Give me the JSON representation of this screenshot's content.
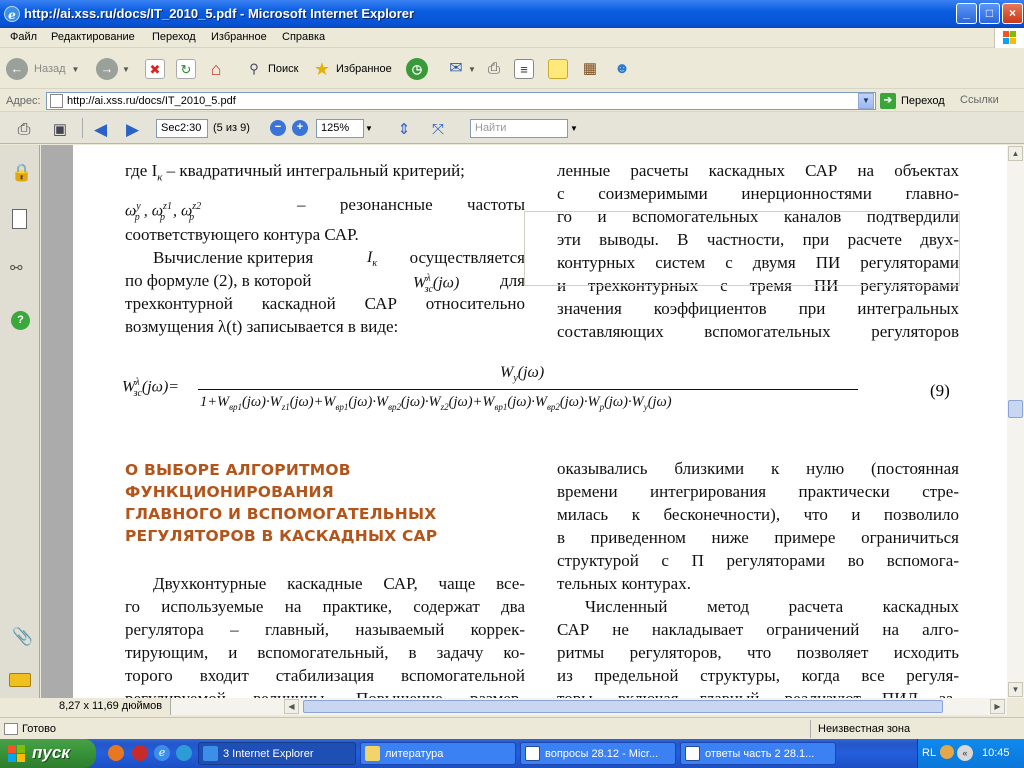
{
  "window": {
    "title": "http://ai.xss.ru/docs/IT_2010_5.pdf - Microsoft Internet Explorer",
    "controls": {
      "minimize": "_",
      "maximize": "□",
      "close": "×"
    }
  },
  "menu": [
    "Файл",
    "Редактирование",
    "Переход",
    "Избранное",
    "Справка"
  ],
  "toolbar": {
    "back": "Назад",
    "search": "Поиск",
    "favorites": "Избранное"
  },
  "address": {
    "label": "Адрес:",
    "url": "http://ai.xss.ru/docs/IT_2010_5.pdf",
    "go": "Переход",
    "links": "Ссылки"
  },
  "pdf": {
    "page_label": "Sec2:30",
    "page_count": "(5 из 9)",
    "zoom": "125%",
    "find_placeholder": "Найти"
  },
  "document": {
    "left_column_top": [
      "где I",
      "к",
      " – квадратичный интегральный критерий;"
    ],
    "resonance_text": "– резонансные частоты",
    "resonance_text2": "соответствующего контура САР.",
    "calc_para": "Вычисление критерия",
    "calc_para2": "осуществляется",
    "calc_para3": "по формуле (2), в которой",
    "calc_para4": "для",
    "calc_para5": "трехконтурной каскадной САР относительно",
    "calc_para6": "возмущения λ(t) записывается в виде:",
    "right_top": [
      "ленные расчеты каскадных САР на объектах",
      "с соизмеримыми инерционностями главно-",
      "го и вспомогательных каналов подтвердили",
      "эти выводы. В частности, при расчете двух-",
      "контурных систем с двумя ПИ регуляторами",
      "и трехконтурных с тремя ПИ регуляторами",
      "значения коэффициентов при интегральных",
      "составляющих вспомогательных регуляторов"
    ],
    "formula_number": "(9)",
    "heading": [
      "О ВЫБОРЕ АЛГОРИТМОВ",
      "ФУНКЦИОНИРОВАНИЯ",
      "ГЛАВНОГО И ВСПОМОГАТЕЛЬНЫХ",
      "РЕГУЛЯТОРОВ В КАСКАДНЫХ САР"
    ],
    "left_bottom": [
      "Двухконтурные каскадные САР, чаще все-",
      "го используемые на практике, содержат два",
      "регулятора – главный, называемый коррек-",
      "тирующим, и вспомогательный, в задачу ко-",
      "торого входит стабилизация вспомогательной",
      "регулируемой величины. Повышение размер-"
    ],
    "right_bottom": [
      "оказывались близкими к нулю (постоянная",
      "времени интегрирования практически стре-",
      "милась к бесконечности), что и позволило",
      "в приведенном ниже примере ограничиться",
      "структурой с П регуляторами во вспомога-",
      "тельных контурах."
    ],
    "right_bottom2": [
      "Численный метод расчета каскадных",
      "САР не накладывает ограничений на алго-",
      "ритмы регуляторов, что позволяет исходить",
      "из предельной структуры, когда все регуля-",
      "торы, включая главный, реализуют ПИД за-"
    ]
  },
  "page_size": "8,27 x 11,69 дюймов",
  "status": {
    "left": "Готово",
    "zone": "Неизвестная зона"
  },
  "taskbar": {
    "start": "пуск",
    "tasks": [
      "3 Internet Explorer",
      "литература",
      "вопросы 28.12 - Micr...",
      "ответы часть 2 28.1..."
    ],
    "lang": "RL",
    "clock": "10:45"
  }
}
